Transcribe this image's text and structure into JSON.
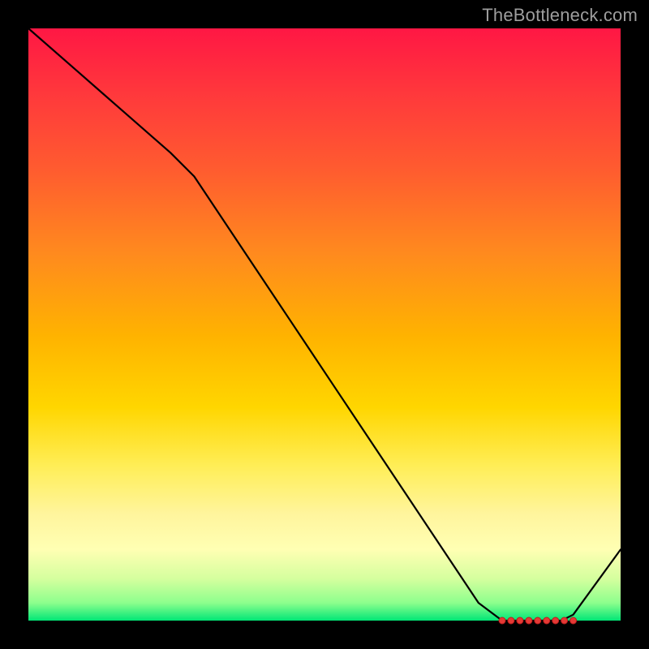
{
  "watermark": "TheBottleneck.com",
  "chart_data": {
    "type": "line",
    "title": "",
    "xlabel": "",
    "ylabel": "",
    "xlim": [
      0,
      100
    ],
    "ylim": [
      0,
      100
    ],
    "grid": false,
    "legend": false,
    "series": [
      {
        "name": "bottleneck-curve",
        "color": "#000000",
        "x": [
          0,
          8,
          16,
          24,
          28,
          36,
          44,
          52,
          60,
          68,
          76,
          80,
          82,
          84,
          86,
          88,
          90,
          92,
          100
        ],
        "values": [
          100,
          93,
          86,
          79,
          75,
          63,
          51,
          39,
          27,
          15,
          3,
          0,
          0,
          0,
          0,
          0,
          0,
          1,
          12
        ]
      }
    ],
    "markers": {
      "name": "optimal-range",
      "color": "#e53935",
      "x": [
        80,
        81.5,
        83,
        84.5,
        86,
        87.5,
        89,
        90.5,
        92
      ],
      "y": [
        0,
        0,
        0,
        0,
        0,
        0,
        0,
        0,
        0
      ]
    }
  }
}
